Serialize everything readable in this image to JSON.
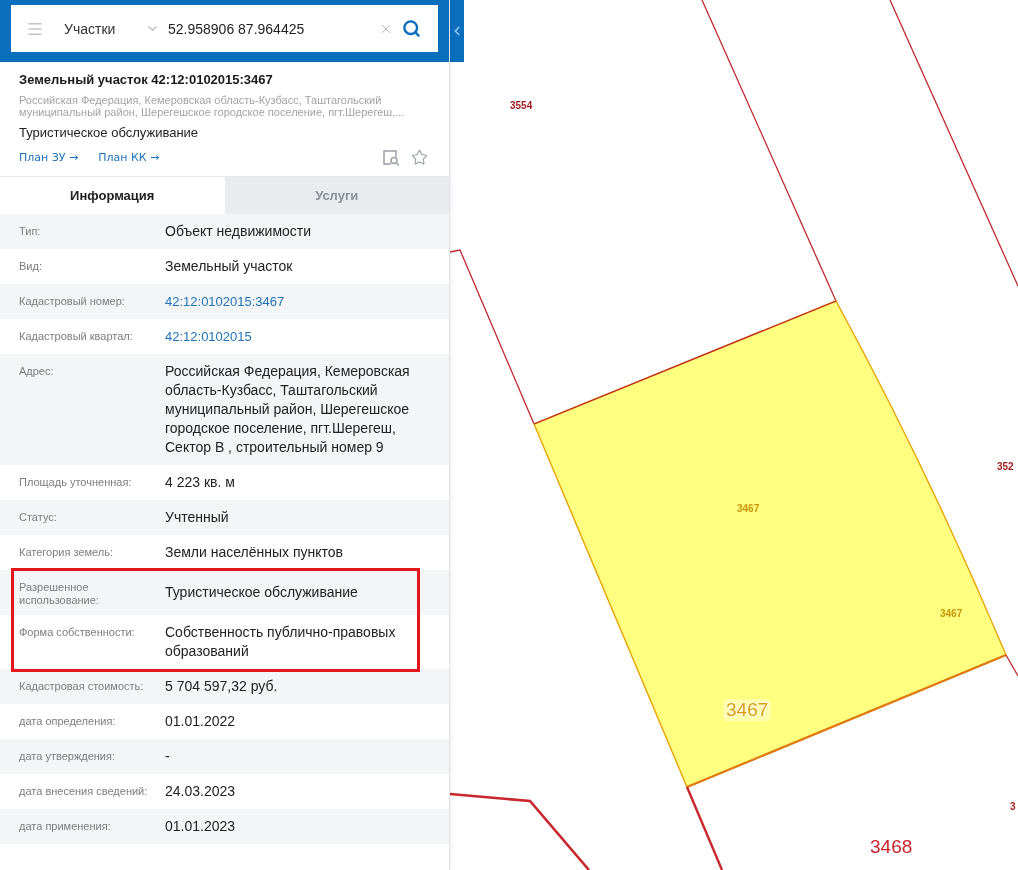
{
  "search_bar": {
    "layer_select": "Участки",
    "query": "52.958906 87.964425"
  },
  "object": {
    "title": "Земельный участок 42:12:0102015:3467",
    "address": "Российская Федерация, Кемеровская область-Кузбасс, Таштагольский муниципальный район, Шерегешское городское поселение, пгт.Шерегеш,...",
    "purpose": "Туристическое обслуживание",
    "links": [
      "План ЗУ →",
      "План КК →"
    ]
  },
  "tabs": [
    {
      "label": "Информация",
      "selected": true
    },
    {
      "label": "Услуги",
      "selected": false
    }
  ],
  "properties": [
    {
      "label": "Тип:",
      "value": "Объект недвижимости",
      "kind": "text",
      "highlighted": false
    },
    {
      "label": "Вид:",
      "value": "Земельный участок",
      "kind": "text",
      "highlighted": false
    },
    {
      "label": "Кадастровый номер:",
      "value": "42:12:0102015:3467",
      "kind": "link",
      "highlighted": false
    },
    {
      "label": "Кадастровый квартал:",
      "value": "42:12:0102015",
      "kind": "link",
      "highlighted": false
    },
    {
      "label": "Адрес:",
      "value": "Российская Федерация, Кемеровская область-Кузбасс, Таштагольский муниципальный район, Шерегешское городское поселение, пгт.Шерегеш, Сектор В , строительный номер 9",
      "kind": "text",
      "highlighted": false
    },
    {
      "label": "Площадь уточненная:",
      "value": "4 223 кв. м",
      "kind": "text",
      "highlighted": false
    },
    {
      "label": "Статус:",
      "value": "Учтенный",
      "kind": "text",
      "highlighted": false
    },
    {
      "label": "Категория земель:",
      "value": "Земли населённых пунктов",
      "kind": "text",
      "highlighted": false
    },
    {
      "label": "Разрешенное использование:",
      "value": "Туристическое обслуживание",
      "kind": "text",
      "highlighted": true
    },
    {
      "label": "Форма собственности:",
      "value": "Собственность публично-правовых образований",
      "kind": "text",
      "highlighted": true
    },
    {
      "label": "Кадастровая стоимость:",
      "value": "5 704 597,32 руб.",
      "kind": "text",
      "highlighted": false
    },
    {
      "label": "дата определения:",
      "value": "01.01.2022",
      "kind": "text",
      "highlighted": false
    },
    {
      "label": "дата утверждения:",
      "value": "-",
      "kind": "text",
      "highlighted": false
    },
    {
      "label": "дата внесения сведений:",
      "value": "24.03.2023",
      "kind": "text",
      "highlighted": false
    },
    {
      "label": "дата применения:",
      "value": "01.01.2023",
      "kind": "text",
      "highlighted": false
    }
  ],
  "map": {
    "labels": [
      {
        "text": "3554",
        "kind": "small",
        "color": "#9e1b1b"
      },
      {
        "text": "352",
        "kind": "small",
        "color": "#9e1b1b"
      },
      {
        "text": "3467",
        "kind": "small",
        "color": "#c9960c"
      },
      {
        "text": "3467",
        "kind": "small",
        "color": "#c9960c"
      },
      {
        "text": "3467",
        "kind": "large",
        "color": "#dc9a1e"
      },
      {
        "text": "3",
        "kind": "small",
        "color": "#9e1b1b"
      },
      {
        "text": "3468",
        "kind": "large",
        "color": "#c8262c"
      }
    ]
  }
}
